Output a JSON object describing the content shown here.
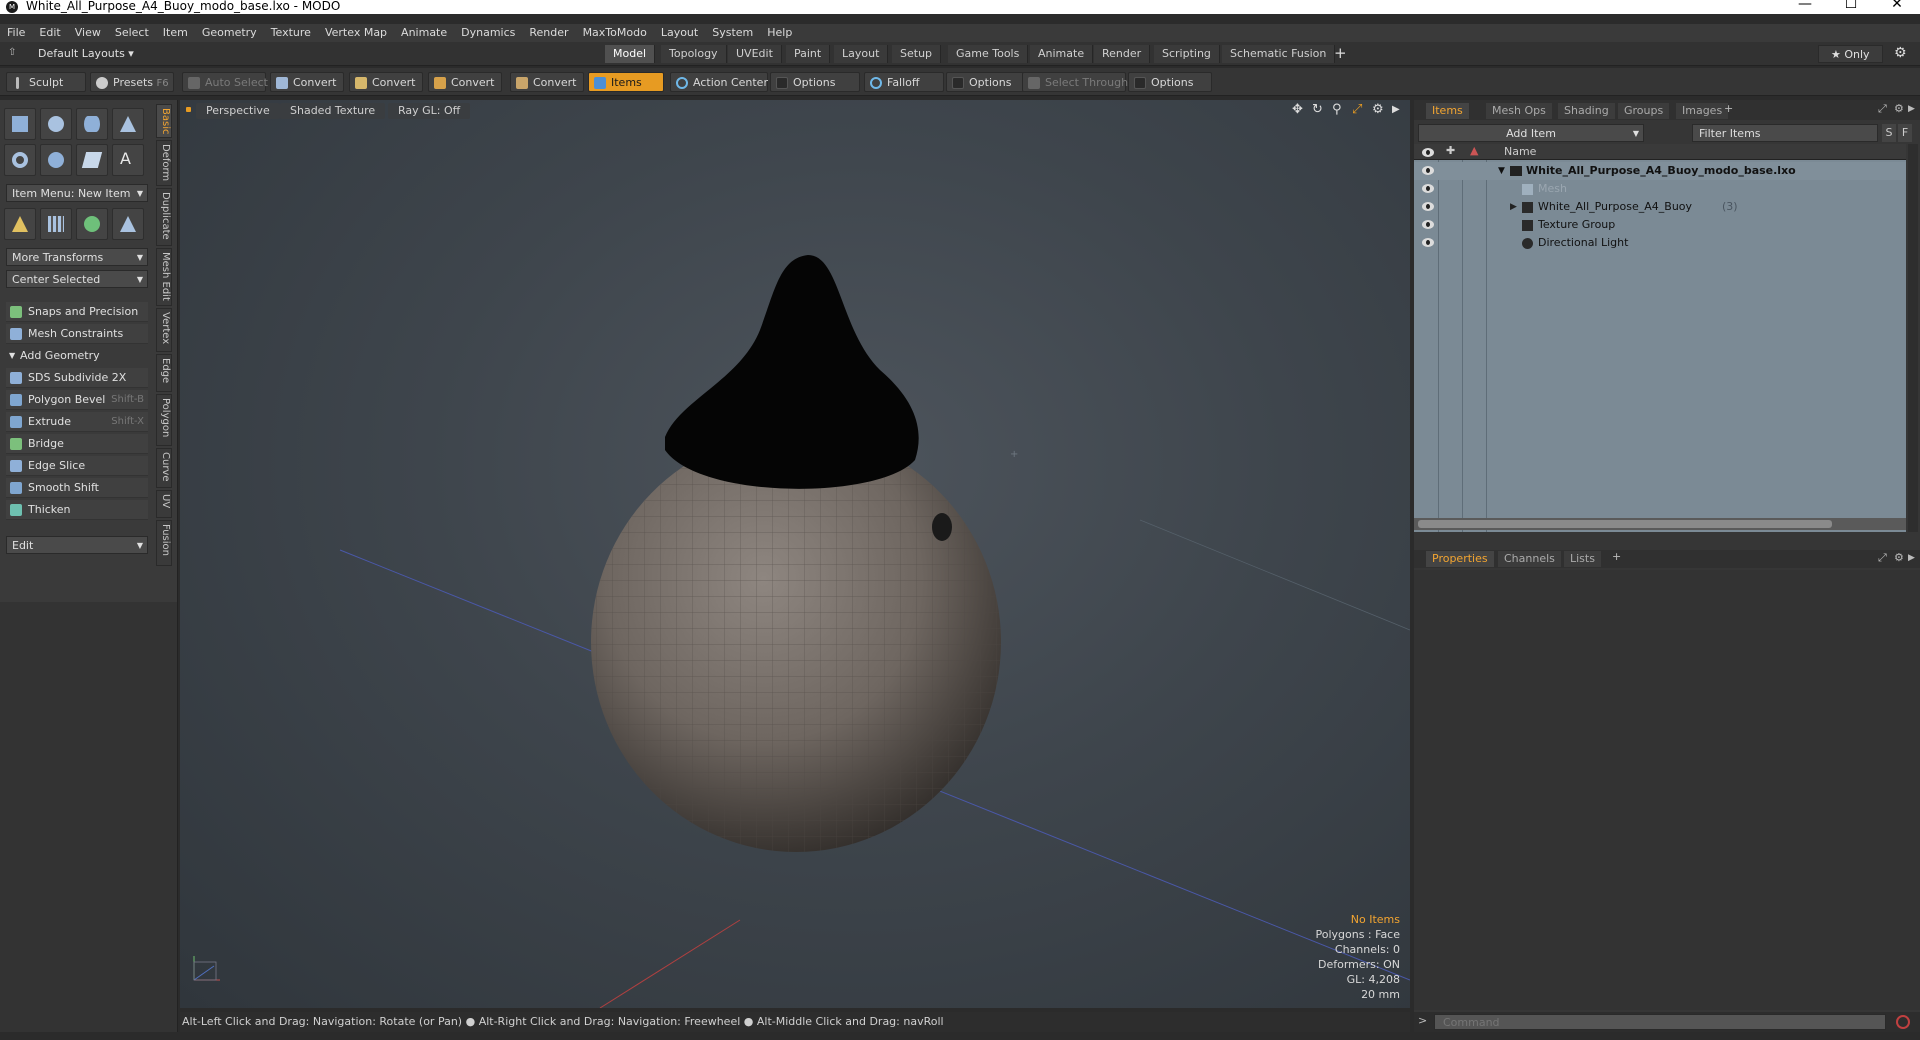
{
  "window": {
    "title": "White_All_Purpose_A4_Buoy_modo_base.lxo - MODO",
    "logo": "M"
  },
  "menu": [
    "File",
    "Edit",
    "View",
    "Select",
    "Item",
    "Geometry",
    "Texture",
    "Vertex Map",
    "Animate",
    "Dynamics",
    "Render",
    "MaxToModo",
    "Layout",
    "System",
    "Help"
  ],
  "layoutbar": {
    "layout_name": "Default Layouts ▾",
    "tabs": [
      "Model",
      "Topology",
      "UVEdit",
      "Paint",
      "Layout",
      "Setup",
      "Game Tools",
      "Animate",
      "Render",
      "Scripting",
      "Schematic Fusion"
    ],
    "active_tab": "Model",
    "plus": "+",
    "only_label": "★  Only"
  },
  "toolbar": {
    "sculpt": "Sculpt",
    "presets": "Presets",
    "presets_key": "F6",
    "auto_select": "Auto Select",
    "convert": "Convert",
    "items": "Items",
    "action_center": "Action Center",
    "options": "Options",
    "falloff": "Falloff",
    "select_through": "Select Through"
  },
  "leftpanel": {
    "item_menu": "Item Menu: New Item",
    "more_transforms": "More Transforms",
    "center_selected": "Center Selected",
    "snaps": "Snaps and Precision",
    "mesh_constraints": "Mesh Constraints",
    "add_geometry": "Add Geometry",
    "tools": [
      {
        "label": "SDS Subdivide 2X",
        "shortcut": ""
      },
      {
        "label": "Polygon Bevel",
        "shortcut": "Shift-B"
      },
      {
        "label": "Extrude",
        "shortcut": "Shift-X"
      },
      {
        "label": "Bridge",
        "shortcut": ""
      },
      {
        "label": "Edge Slice",
        "shortcut": ""
      },
      {
        "label": "Smooth Shift",
        "shortcut": ""
      },
      {
        "label": "Thicken",
        "shortcut": ""
      }
    ],
    "edit": "Edit",
    "vtabs": [
      "Basic",
      "Deform",
      "Duplicate",
      "Mesh Edit",
      "Vertex",
      "Edge",
      "Polygon",
      "Curve",
      "UV",
      "Fusion"
    ]
  },
  "viewport": {
    "view": "Perspective",
    "shading": "Shaded Texture",
    "raygl": "Ray GL: Off",
    "stats": {
      "items": "No Items",
      "polygons": "Polygons : Face",
      "channels": "Channels: 0",
      "deformers": "Deformers: ON",
      "gl": "GL: 4,208",
      "scale": "20 mm"
    }
  },
  "statusbar": "Alt-Left Click and Drag: Navigation: Rotate (or Pan) ●  Alt-Right Click and Drag: Navigation: Freewheel ●  Alt-Middle Click and Drag: navRoll",
  "rightpanel": {
    "tabs": [
      "Items",
      "Mesh Ops",
      "Shading",
      "Groups",
      "Images"
    ],
    "add_item": "Add Item",
    "filter": "Filter Items",
    "s": "S",
    "f": "F",
    "col_name": "Name",
    "tree": [
      {
        "label": "White_All_Purpose_A4_Buoy_modo_base.lxo",
        "count": ""
      },
      {
        "label": "Mesh",
        "count": ""
      },
      {
        "label": "White_All_Purpose_A4_Buoy",
        "count": "(3)"
      },
      {
        "label": "Texture Group",
        "count": ""
      },
      {
        "label": "Directional Light",
        "count": ""
      }
    ],
    "props_tabs": [
      "Properties",
      "Channels",
      "Lists"
    ],
    "command_placeholder": "Command"
  },
  "colors": {
    "accent": "#f3a531",
    "highlight": "#e79b22"
  }
}
